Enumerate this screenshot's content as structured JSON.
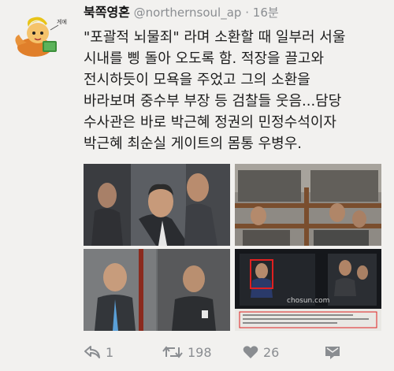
{
  "tweet": {
    "author_name": "북쪽영혼",
    "handle": "@northernsoul_ap",
    "separator": "·",
    "time": "16분",
    "text_lines": [
      "\"포괄적 뇌물죄\" 라며 소환할 때 일부러 서울",
      "시내를 삥 돌아 오도록 함. 적장을 끌고와",
      "전시하듯이 모욕을 주었고 그의 소환을",
      "바라보며 중수부 부장 등 검찰들 웃음...담당",
      "수사관은 바로 박근혜 정권의 민정수석이자",
      "박근혜 최순실 게이트의 몸통 우병우."
    ],
    "media_watermark": "chosun.com",
    "avatar_caption": "게에"
  },
  "actions": {
    "reply_count": "1",
    "retweet_count": "198",
    "like_count": "26"
  },
  "colors": {
    "background": "#f2f1ef",
    "action_gray": "#8a8d91",
    "highlight_red": "#e02020"
  },
  "icons": {
    "reply": "reply-icon",
    "retweet": "retweet-icon",
    "like": "heart-icon",
    "dm": "envelope-icon"
  }
}
